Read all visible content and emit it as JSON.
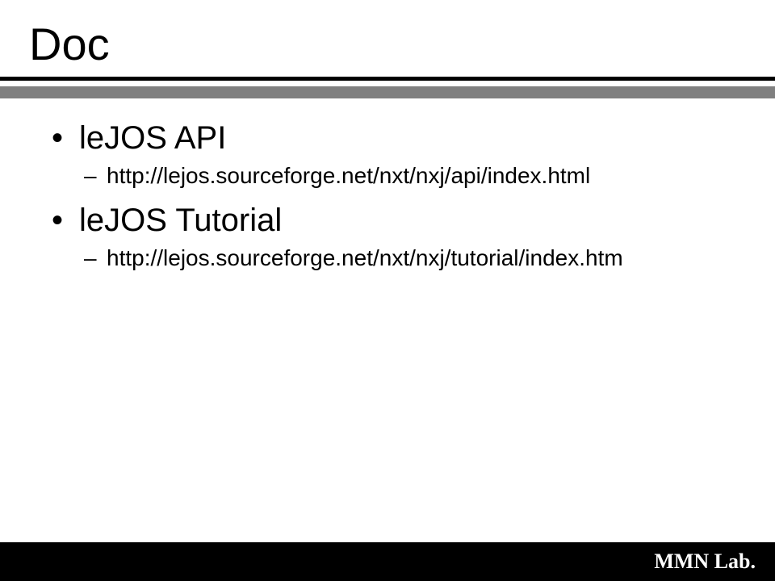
{
  "title": "Doc",
  "bullets": [
    {
      "text": "leJOS API",
      "sub": [
        "http://lejos.sourceforge.net/nxt/nxj/api/index.html"
      ]
    },
    {
      "text": "leJOS Tutorial",
      "sub": [
        "http://lejos.sourceforge.net/nxt/nxj/tutorial/index.htm"
      ]
    }
  ],
  "footer": "MMN Lab."
}
